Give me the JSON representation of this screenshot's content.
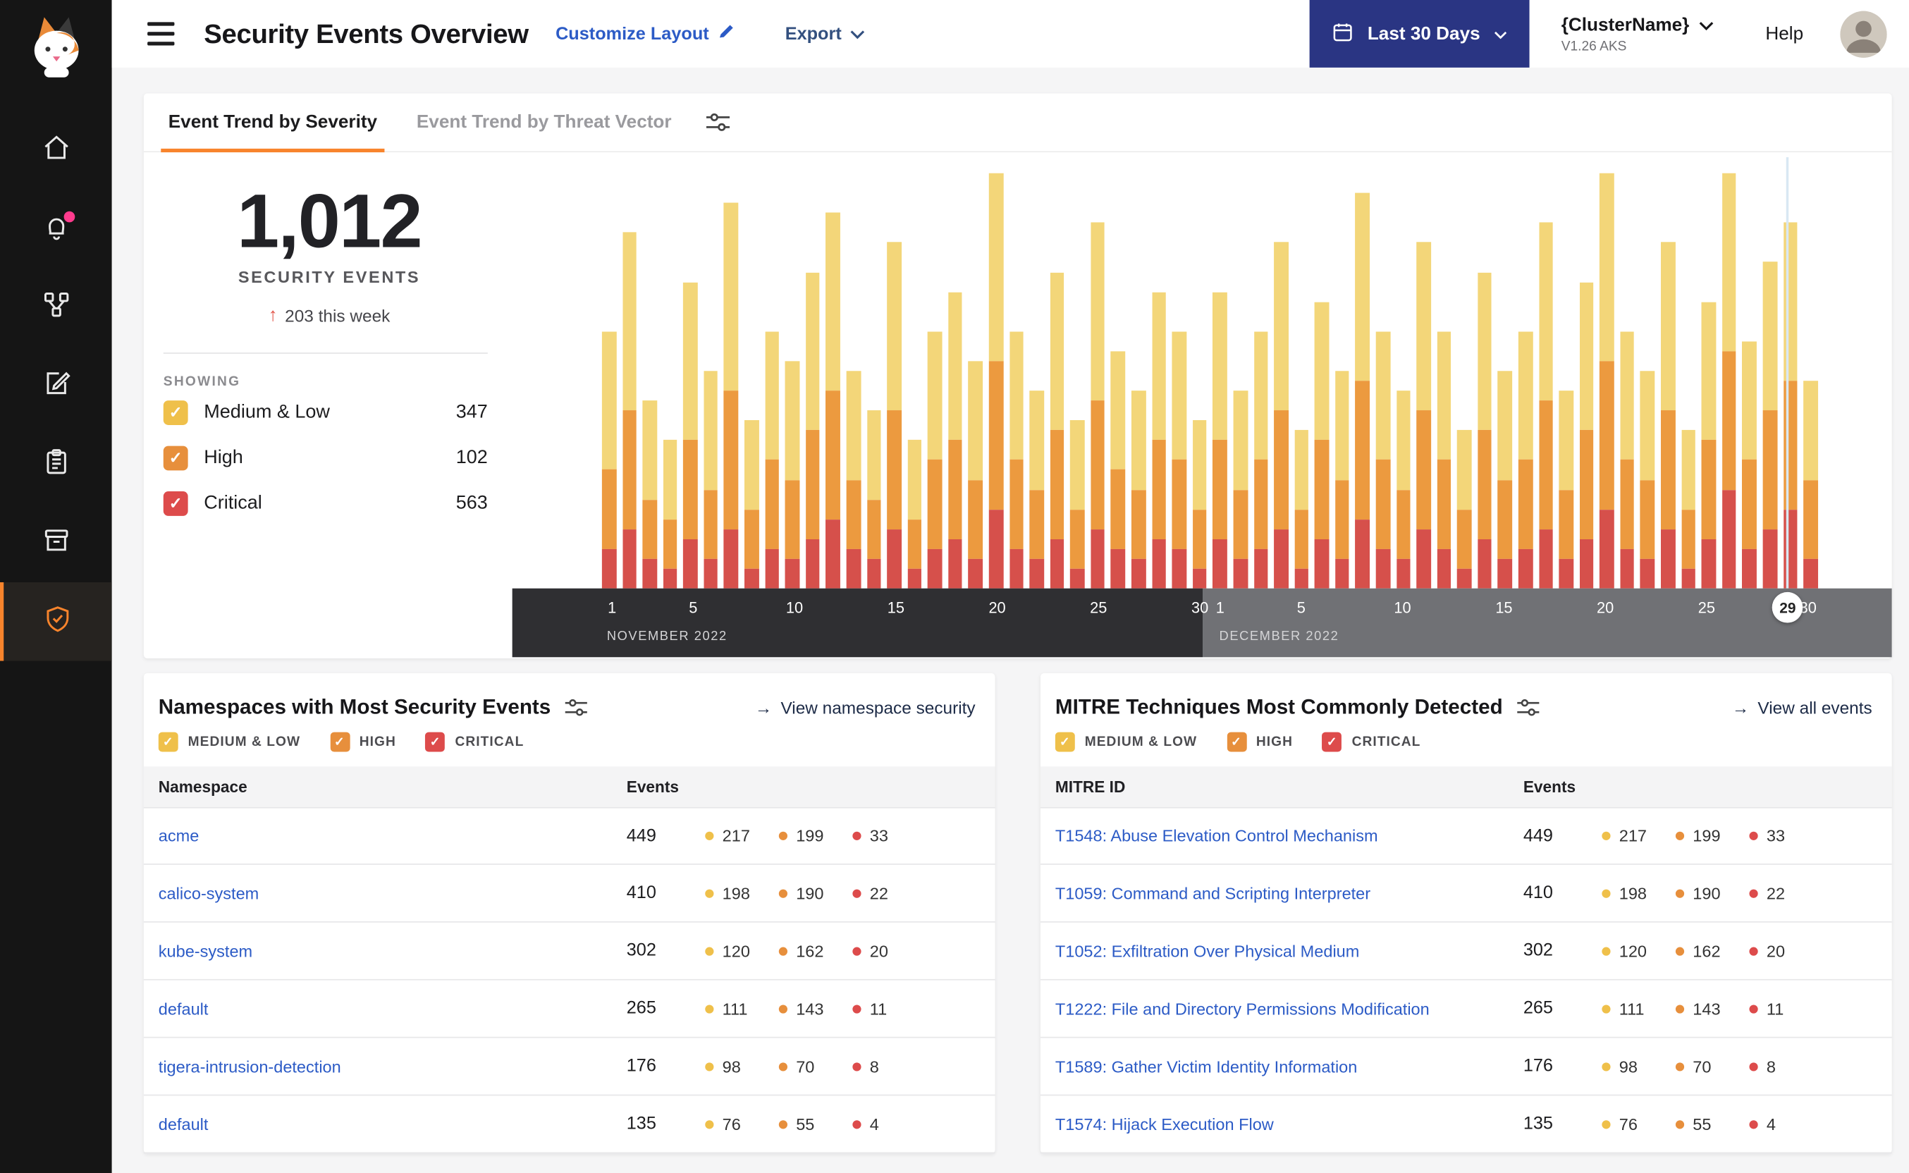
{
  "severity_colors": {
    "medium": "#EFC04A",
    "high": "#E78F3C",
    "critical": "#DD4B4B"
  },
  "chart_colors": {
    "medium": "#F3D679",
    "high": "#EC9A3F",
    "critical": "#D6504B"
  },
  "accent_orange": "#F8842C",
  "header": {
    "title": "Security Events Overview",
    "customize_layout": "Customize Layout",
    "export_label": "Export",
    "date_range": "Last 30 Days",
    "cluster_name": "{ClusterName}",
    "cluster_version": "V1.26 AKS",
    "help": "Help"
  },
  "sidebar": {
    "icons": [
      "home-icon",
      "notifications-icon",
      "service-graph-icon",
      "compliance-icon",
      "policies-icon",
      "workloads-icon",
      "security-events-icon"
    ],
    "active": "security-events-icon"
  },
  "tabs": [
    {
      "label": "Event Trend by Severity",
      "active": true
    },
    {
      "label": "Event Trend by Threat Vector",
      "active": false
    }
  ],
  "summary": {
    "total": "1,012",
    "total_label": "SECURITY EVENTS",
    "delta_arrow": "↑",
    "delta": "203 this week",
    "showing_label": "SHOWING",
    "filters": [
      {
        "label": "Medium & Low",
        "key": "medium",
        "count": "347",
        "checked": true
      },
      {
        "label": "High",
        "key": "high",
        "count": "102",
        "checked": true
      },
      {
        "label": "Critical",
        "key": "critical",
        "count": "563",
        "checked": true
      }
    ]
  },
  "chart_data": {
    "type": "bar",
    "stacked": true,
    "title": "Event Trend by Severity",
    "ylim": [
      0,
      45
    ],
    "grid": false,
    "months": [
      {
        "label": "NOVEMBER 2022",
        "days": 30,
        "ticks": [
          1,
          5,
          10,
          15,
          20,
          25,
          30
        ]
      },
      {
        "label": "DECEMBER 2022",
        "days": 30,
        "ticks": [
          1,
          5,
          10,
          15,
          20,
          25,
          30
        ]
      }
    ],
    "selected": {
      "month": 1,
      "day": 29
    },
    "series": [
      {
        "name": "Critical",
        "key": "critical",
        "values": [
          4,
          6,
          3,
          2,
          5,
          3,
          6,
          2,
          4,
          3,
          5,
          7,
          4,
          3,
          6,
          2,
          4,
          5,
          3,
          8,
          4,
          3,
          5,
          2,
          6,
          4,
          3,
          5,
          4,
          2,
          5,
          3,
          4,
          6,
          2,
          5,
          3,
          7,
          4,
          3,
          6,
          4,
          2,
          5,
          3,
          4,
          6,
          3,
          5,
          8,
          4,
          3,
          6,
          2,
          5,
          10,
          4,
          6,
          8,
          3
        ]
      },
      {
        "name": "High",
        "key": "high",
        "values": [
          8,
          12,
          6,
          5,
          10,
          7,
          14,
          6,
          9,
          8,
          11,
          13,
          7,
          6,
          12,
          5,
          9,
          10,
          8,
          15,
          9,
          7,
          11,
          6,
          13,
          8,
          7,
          10,
          9,
          6,
          10,
          7,
          9,
          12,
          6,
          10,
          8,
          14,
          9,
          7,
          12,
          9,
          6,
          11,
          8,
          9,
          13,
          7,
          11,
          15,
          9,
          8,
          12,
          6,
          10,
          14,
          9,
          12,
          13,
          8
        ]
      },
      {
        "name": "Medium & Low",
        "key": "medium",
        "values": [
          14,
          18,
          10,
          8,
          16,
          12,
          19,
          9,
          13,
          12,
          16,
          18,
          11,
          9,
          17,
          8,
          13,
          15,
          12,
          19,
          13,
          10,
          16,
          9,
          18,
          12,
          10,
          15,
          13,
          9,
          15,
          10,
          13,
          17,
          8,
          14,
          11,
          19,
          13,
          10,
          17,
          13,
          8,
          16,
          11,
          13,
          18,
          10,
          15,
          19,
          13,
          11,
          17,
          8,
          14,
          18,
          12,
          15,
          16,
          10
        ]
      }
    ]
  },
  "namespace_card": {
    "title": "Namespaces with Most Security Events",
    "link_arrow": "→",
    "link": "View namespace security",
    "filters": [
      {
        "label": "MEDIUM & LOW",
        "key": "medium"
      },
      {
        "label": "HIGH",
        "key": "high"
      },
      {
        "label": "CRITICAL",
        "key": "critical"
      }
    ],
    "columns": [
      "Namespace",
      "Events"
    ],
    "rows": [
      {
        "name": "acme",
        "total": "449",
        "medium": "217",
        "high": "199",
        "critical": "33"
      },
      {
        "name": "calico-system",
        "total": "410",
        "medium": "198",
        "high": "190",
        "critical": "22"
      },
      {
        "name": "kube-system",
        "total": "302",
        "medium": "120",
        "high": "162",
        "critical": "20"
      },
      {
        "name": "default",
        "total": "265",
        "medium": "111",
        "high": "143",
        "critical": "11"
      },
      {
        "name": "tigera-intrusion-detection",
        "total": "176",
        "medium": "98",
        "high": "70",
        "critical": "8"
      },
      {
        "name": "default",
        "total": "135",
        "medium": "76",
        "high": "55",
        "critical": "4"
      }
    ]
  },
  "mitre_card": {
    "title": "MITRE Techniques Most Commonly Detected",
    "link_arrow": "→",
    "link": "View all events",
    "filters": [
      {
        "label": "MEDIUM & LOW",
        "key": "medium"
      },
      {
        "label": "HIGH",
        "key": "high"
      },
      {
        "label": "CRITICAL",
        "key": "critical"
      }
    ],
    "columns": [
      "MITRE ID",
      "Events"
    ],
    "rows": [
      {
        "name": "T1548: Abuse Elevation Control Mechanism",
        "total": "449",
        "medium": "217",
        "high": "199",
        "critical": "33"
      },
      {
        "name": "T1059: Command and Scripting Interpreter",
        "total": "410",
        "medium": "198",
        "high": "190",
        "critical": "22"
      },
      {
        "name": "T1052: Exfiltration Over Physical Medium",
        "total": "302",
        "medium": "120",
        "high": "162",
        "critical": "20"
      },
      {
        "name": "T1222: File and Directory Permissions Modification",
        "total": "265",
        "medium": "111",
        "high": "143",
        "critical": "11"
      },
      {
        "name": "T1589: Gather Victim Identity Information",
        "total": "176",
        "medium": "98",
        "high": "70",
        "critical": "8"
      },
      {
        "name": "T1574: Hijack Execution Flow",
        "total": "135",
        "medium": "76",
        "high": "55",
        "critical": "4"
      }
    ]
  }
}
